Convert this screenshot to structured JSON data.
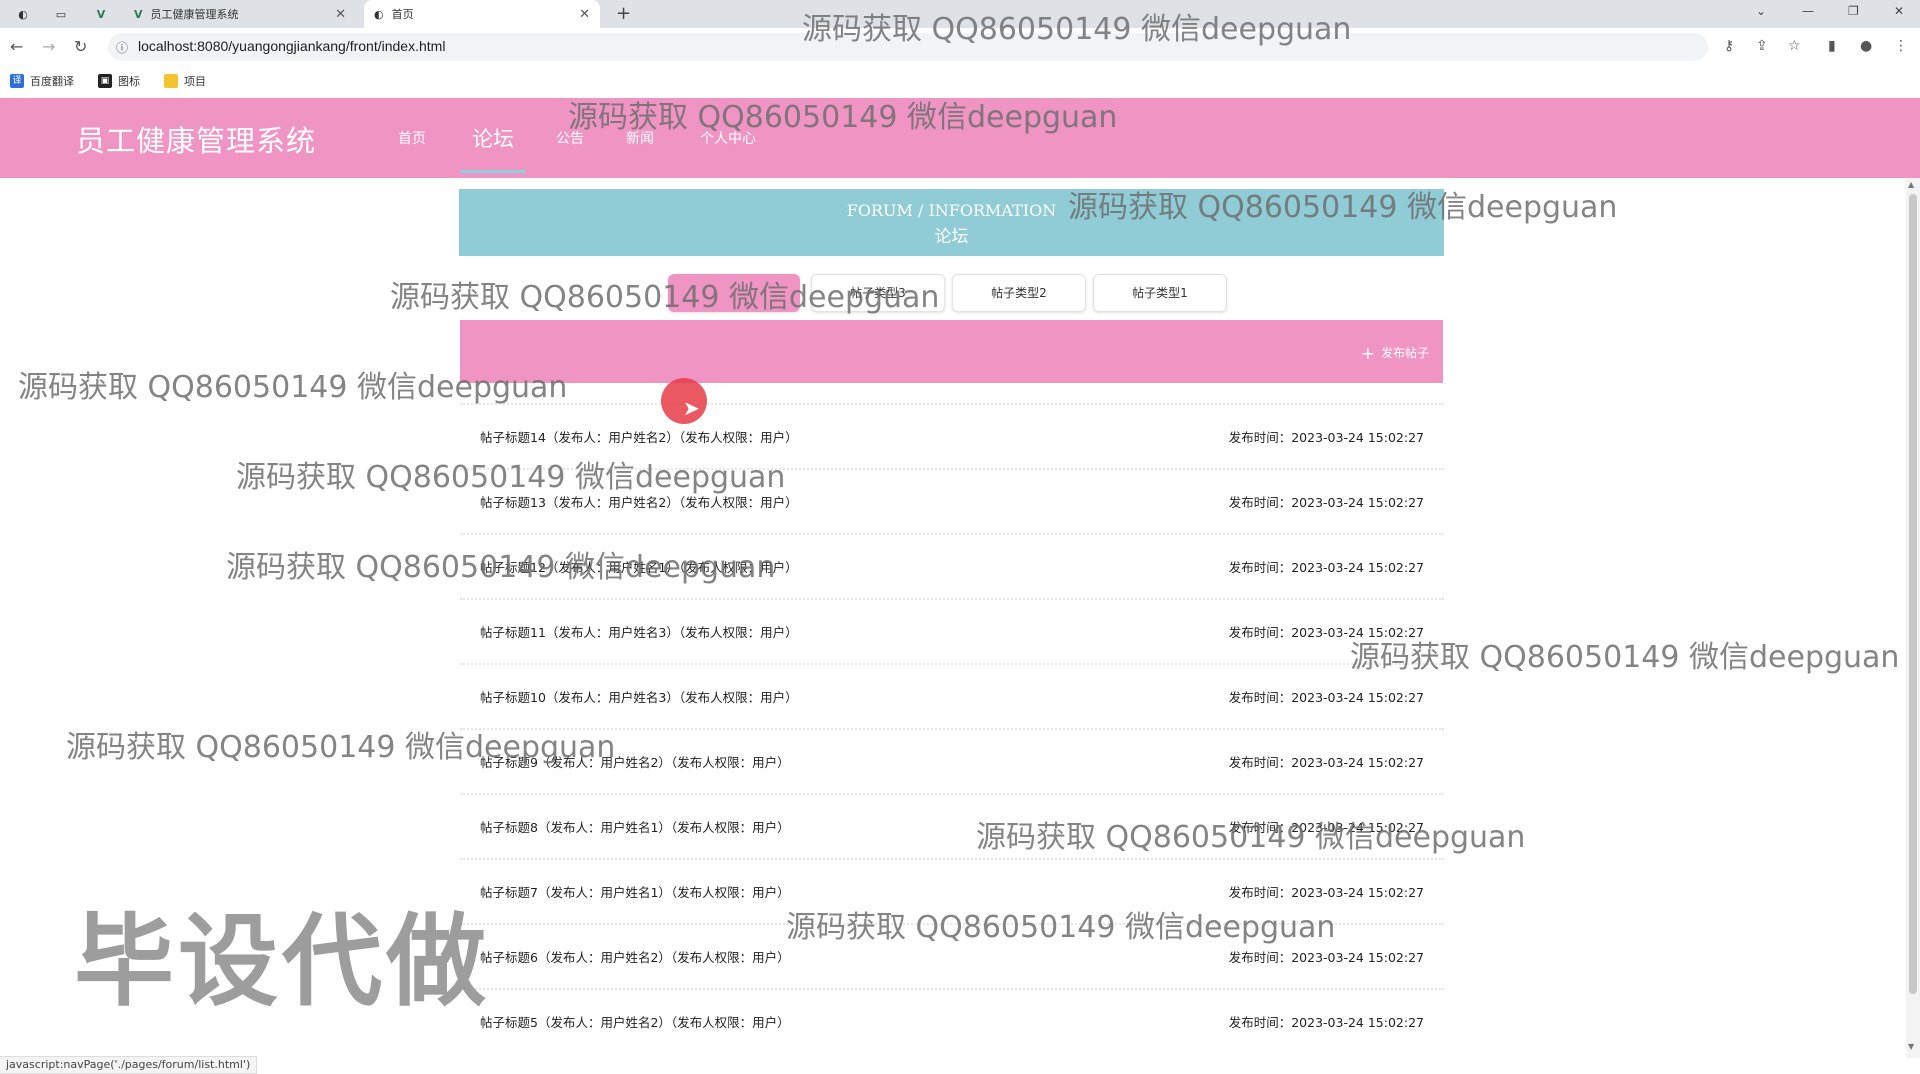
{
  "browser": {
    "tabs": [
      {
        "label": "员工健康管理系统",
        "active": false
      },
      {
        "label": "首页",
        "active": true
      }
    ],
    "url": "localhost:8080/yuangongjiankang/front/index.html",
    "bookmarks": [
      "百度翻译",
      "图标",
      "项目"
    ],
    "status_url": "javascript:navPage('./pages/forum/list.html')"
  },
  "header": {
    "logo": "员工健康管理系统",
    "nav": [
      "首页",
      "论坛",
      "公告",
      "新闻",
      "个人中心"
    ],
    "active_nav": "论坛"
  },
  "banner": {
    "en": "FORUM / INFORMATION",
    "cn": "论坛"
  },
  "categories": [
    "帖子类型3",
    "帖子类型2",
    "帖子类型1"
  ],
  "post_button": "发布帖子",
  "posts": [
    {
      "title": "帖子标题14（发布人：用户姓名2）（发布人权限：用户）",
      "time": "发布时间：2023-03-24 15:02:27"
    },
    {
      "title": "帖子标题13（发布人：用户姓名2）（发布人权限：用户）",
      "time": "发布时间：2023-03-24 15:02:27"
    },
    {
      "title": "帖子标题12（发布人：用户姓名1）（发布人权限：用户）",
      "time": "发布时间：2023-03-24 15:02:27"
    },
    {
      "title": "帖子标题11（发布人：用户姓名3）（发布人权限：用户）",
      "time": "发布时间：2023-03-24 15:02:27"
    },
    {
      "title": "帖子标题10（发布人：用户姓名3）（发布人权限：用户）",
      "time": "发布时间：2023-03-24 15:02:27"
    },
    {
      "title": "帖子标题9（发布人：用户姓名2）（发布人权限：用户）",
      "time": "发布时间：2023-03-24 15:02:27"
    },
    {
      "title": "帖子标题8（发布人：用户姓名1）（发布人权限：用户）",
      "time": "发布时间：2023-03-24 15:02:27"
    },
    {
      "title": "帖子标题7（发布人：用户姓名1）（发布人权限：用户）",
      "time": "发布时间：2023-03-24 15:02:27"
    },
    {
      "title": "帖子标题6（发布人：用户姓名2）（发布人权限：用户）",
      "time": "发布时间：2023-03-24 15:02:27"
    },
    {
      "title": "帖子标题5（发布人：用户姓名2）（发布人权限：用户）",
      "time": "发布时间：2023-03-24 15:02:27"
    }
  ],
  "watermark": {
    "text": "源码获取 QQ86050149 微信deepguan",
    "big": "毕设代做"
  },
  "colors": {
    "brand_pink": "#f094c4",
    "banner_teal": "#90ccd6"
  }
}
